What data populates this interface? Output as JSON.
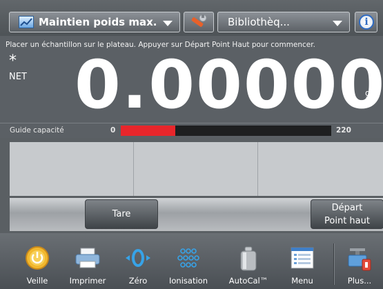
{
  "topbar": {
    "app_mode": "Maintien poids max.",
    "library": "Bibliothèq..."
  },
  "display": {
    "instruction": "Placer un échantillon sur le plateau. Appuyer sur Départ Point Haut pour commencer.",
    "stable_indicator": "*",
    "net_label": "NET",
    "weight": "0.00000",
    "unit": "g"
  },
  "capacity": {
    "label": "Guide capacité",
    "min": "0",
    "max": "220",
    "fill_fraction": 0.26
  },
  "actions": {
    "tare": "Tare",
    "start_line1": "Départ",
    "start_line2": "Point haut"
  },
  "nav": [
    {
      "label": "Veille",
      "icon": "power-icon"
    },
    {
      "label": "Imprimer",
      "icon": "printer-icon"
    },
    {
      "label": "Zéro",
      "icon": "zero-icon"
    },
    {
      "label": "Ionisation",
      "icon": "ionisation-icon"
    },
    {
      "label": "AutoCal™",
      "icon": "calibration-weight-icon"
    },
    {
      "label": "Menu",
      "icon": "menu-icon"
    },
    {
      "label": "Plus...",
      "icon": "more-icon"
    }
  ],
  "colors": {
    "capacity_fill": "#e8262b",
    "background": "#5b6065"
  }
}
